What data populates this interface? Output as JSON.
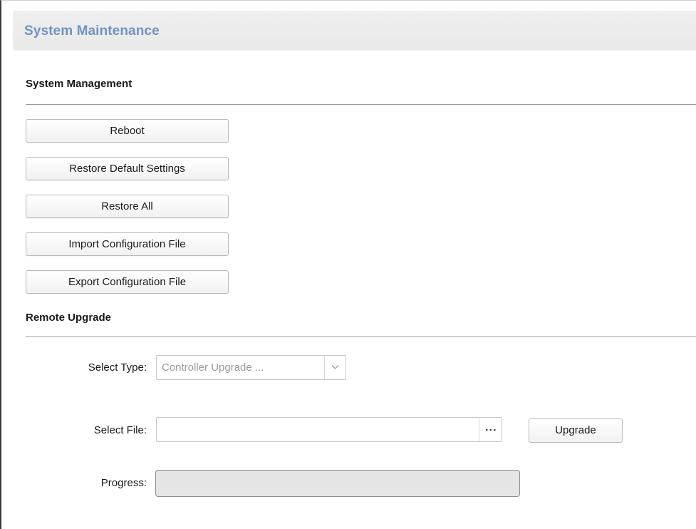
{
  "page": {
    "title": "System Maintenance"
  },
  "system_management": {
    "title": "System Management",
    "buttons": [
      {
        "label": "Reboot"
      },
      {
        "label": "Restore Default Settings"
      },
      {
        "label": "Restore All"
      },
      {
        "label": "Import Configuration File"
      },
      {
        "label": "Export Configuration File"
      }
    ]
  },
  "remote_upgrade": {
    "title": "Remote Upgrade",
    "select_type": {
      "label": "Select Type:",
      "value": "Controller Upgrade ...",
      "icon": "chevron-down-icon"
    },
    "select_file": {
      "label": "Select File:",
      "value": "",
      "browse_icon": "ellipsis-icon"
    },
    "upgrade_button": {
      "label": "Upgrade"
    },
    "progress": {
      "label": "Progress:",
      "value": 0
    }
  },
  "colors": {
    "title_blue": "#6f93c3",
    "header_bg": "#ececec",
    "progress_bg": "#e5e5e5"
  }
}
